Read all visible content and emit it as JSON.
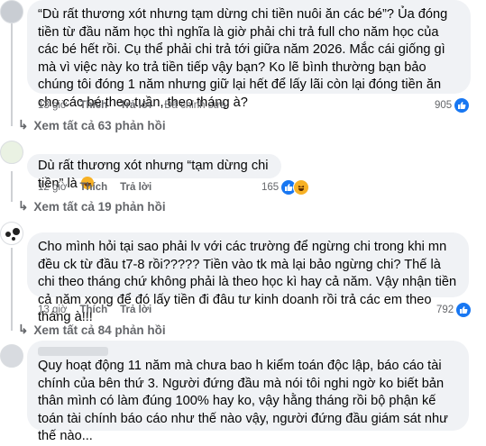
{
  "comments": [
    {
      "text": "“Dù rất thương xót nhưng tạm dừng chi tiền nuôi ăn các bé”? Ủa đóng tiền từ đầu năm học thì nghĩa là giờ phải chi trả full cho năm học của các bé hết rồi. Cụ thể phải chi trả tới giữa năm 2026. Mắc cái giống gì mà vì việc này ko trả tiền tiếp vậy bạn? Ko lẽ bình thường bạn bảo chúng tôi đóng 1 năm nhưng giữ lại hết để lấy lãi còn lại đóng tiền ăn cho các bé theo tuần, theo tháng à?",
      "time": "13 giờ",
      "like_label": "Thích",
      "reply_label": "Trả lời",
      "edited_label": "Đã chỉnh sửa",
      "reaction_count": "905",
      "view_more": "Xem tất cả 63 phản hồi"
    },
    {
      "text": "Dù rất thương xót nhưng “tạm dừng chi tiền” là ",
      "time": "12 giờ",
      "like_label": "Thích",
      "reply_label": "Trả lời",
      "reaction_count": "165",
      "view_more": "Xem tất cả 19 phản hồi"
    },
    {
      "text": "Cho mình hỏi tại sao phải lv với các trường để ngừng chi trong khi mn đều ck từ đầu t7-8 rồi????? Tiền vào tk mà lại bảo ngừng chi? Thế là chi theo tháng chứ không phải là theo học kì hay cả năm. Vậy nhận tiền cả năm xong để đó lấy tiền đi đâu tư kinh doanh rồi trả các em theo tháng à!!!",
      "time": "13 giờ",
      "like_label": "Thích",
      "reply_label": "Trả lời",
      "reaction_count": "792",
      "view_more": "Xem tất cả 84 phản hồi"
    },
    {
      "text": "Quy hoạt động 11 năm mà chưa bao h kiểm toán độc lập, báo cáo tài chính của bên thứ 3. Người đứng đầu mà nói tôi nghi ngờ ko biết bản thân mình có làm đúng 100% hay ko, vậy hằng tháng rồi bộ phận kế toán tài chính báo cáo như thế nào vậy, người đứng đầu giám sát như thế nào..."
    }
  ],
  "colors": {
    "bubble_bg": "#f0f2f5",
    "meta_text": "#65676b",
    "like_blue": "#1877f2",
    "haha_yellow": "#f7b125"
  },
  "icons": [
    "like-icon",
    "haha-icon",
    "reply-arrow-icon"
  ]
}
